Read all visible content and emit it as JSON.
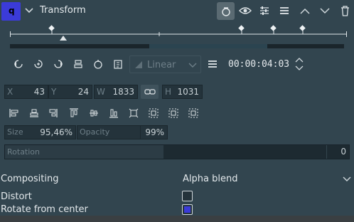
{
  "header": {
    "title": "Transform",
    "badge": "q",
    "icons": [
      "chevron-down-icon",
      "keyframe-toggle-icon",
      "eye-icon",
      "adjust-icon",
      "menu-icon",
      "chevron-up-icon",
      "chevron-down-icon",
      "trash-icon"
    ]
  },
  "keyframe_toolbar": {
    "interpolation": "Linear",
    "timecode": "00:00:04:03"
  },
  "geometry": {
    "x_label": "X",
    "x_value": "43",
    "y_label": "Y",
    "y_value": "24",
    "w_label": "W",
    "w_value": "1833",
    "h_label": "H",
    "h_value": "1031"
  },
  "size": {
    "label": "Size",
    "value": "95,46%"
  },
  "opacity": {
    "label": "Opacity",
    "value": "99%"
  },
  "rotation": {
    "label": "Rotation",
    "value": "0",
    "fraction": 0.46
  },
  "compositing": {
    "label": "Compositing",
    "value": "Alpha blend"
  },
  "distort": {
    "label": "Distort",
    "checked": false
  },
  "rotate_center": {
    "label": "Rotate from center",
    "checked": true
  },
  "colors": {
    "accent": "#3b3bd9",
    "background": "#32454f",
    "field": "#24333b"
  }
}
